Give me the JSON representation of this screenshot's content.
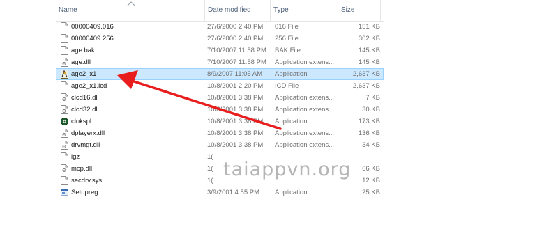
{
  "columns": {
    "name": "Name",
    "date": "Date modified",
    "type": "Type",
    "size": "Size"
  },
  "files": [
    {
      "name": "00000409.016",
      "date": "27/6/2000 2:40 PM",
      "type": "016 File",
      "size": "151 KB",
      "icon": "doc-icon"
    },
    {
      "name": "00000409.256",
      "date": "27/6/2000 2:40 PM",
      "type": "256 File",
      "size": "302 KB",
      "icon": "doc-icon"
    },
    {
      "name": "age.bak",
      "date": "7/10/2007 11:58 PM",
      "type": "BAK File",
      "size": "145 KB",
      "icon": "doc-icon"
    },
    {
      "name": "age.dll",
      "date": "7/10/2007 11:58 PM",
      "type": "Application extens...",
      "size": "145 KB",
      "icon": "dll-icon"
    },
    {
      "name": "age2_x1",
      "date": "8/9/2007 11:05 AM",
      "type": "Application",
      "size": "2,637 KB",
      "icon": "age-app-icon",
      "selected": true
    },
    {
      "name": "age2_x1.icd",
      "date": "10/8/2001 2:20 PM",
      "type": "ICD File",
      "size": "2,637 KB",
      "icon": "doc-icon"
    },
    {
      "name": "clcd16.dll",
      "date": "10/8/2001 3:38 PM",
      "type": "Application extens...",
      "size": "7 KB",
      "icon": "dll-icon"
    },
    {
      "name": "clcd32.dll",
      "date": "10/8/2001 3:38 PM",
      "type": "Application extens...",
      "size": "30 KB",
      "icon": "dll-icon"
    },
    {
      "name": "clokspl",
      "date": "10/8/2001 3:38 PM",
      "type": "Application",
      "size": "173 KB",
      "icon": "app-icon"
    },
    {
      "name": "dplayerx.dll",
      "date": "10/8/2001 3:38 PM",
      "type": "Application extens...",
      "size": "136 KB",
      "icon": "dll-icon"
    },
    {
      "name": "drvmgt.dll",
      "date": "10/8/2001 3:38 PM",
      "type": "Application extens...",
      "size": "34 KB",
      "icon": "dll-icon"
    },
    {
      "name": "igz",
      "date": "1(",
      "type": "",
      "size": "",
      "icon": "doc-icon"
    },
    {
      "name": "mcp.dll",
      "date": "1(",
      "type": "",
      "size": "66 KB",
      "icon": "dll-icon"
    },
    {
      "name": "secdrv.sys",
      "date": "1(",
      "type": "",
      "size": "12 KB",
      "icon": "doc-icon"
    },
    {
      "name": "Setupreg",
      "date": "3/9/2001 4:55 PM",
      "type": "Application",
      "size": "25 KB",
      "icon": "setup-app-icon"
    }
  ],
  "watermark": "taiappvn.org",
  "colors": {
    "selection": "#cce8ff",
    "selection_border": "#99d1ff",
    "arrow": "#e81e1e",
    "header_text": "#4c607a"
  }
}
